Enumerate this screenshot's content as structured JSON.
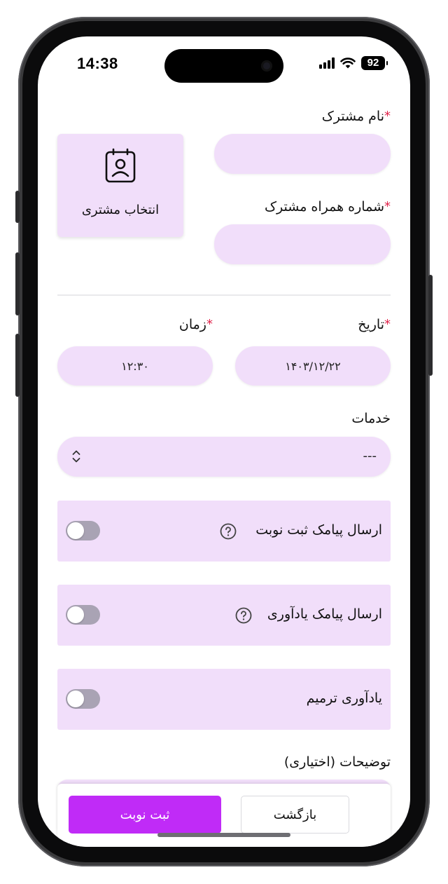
{
  "status_bar": {
    "time": "14:38",
    "battery": "92",
    "icons": [
      "cellular-signal-icon",
      "wifi-icon",
      "battery-icon"
    ]
  },
  "customer": {
    "name_label": "نام مشترک",
    "name_value": "",
    "phone_label": "شماره همراه مشترک",
    "phone_value": "",
    "required_mark": "*",
    "pick_button_label": "انتخاب مشتری",
    "pick_button_icon": "contact-book-icon"
  },
  "appointment": {
    "date_label": "تاریخ",
    "date_value": "۱۴۰۳/۱۲/۲۲",
    "time_label": "زمان",
    "time_value": "۱۲:۳۰"
  },
  "services": {
    "label": "خدمات",
    "selected": "---"
  },
  "toggles": [
    {
      "label": "ارسال پیامک ثبت نوبت",
      "has_help": true,
      "on": false
    },
    {
      "label": "ارسال پیامک یادآوری",
      "has_help": true,
      "on": false
    },
    {
      "label": "یادآوری ترمیم",
      "has_help": false,
      "on": false
    }
  ],
  "notes": {
    "label": "توضیحات (اختیاری)"
  },
  "actions": {
    "back_label": "بازگشت",
    "submit_label": "ثبت نوبت"
  },
  "colors": {
    "field_bg": "#f1defa",
    "primary": "#c02bf7",
    "required": "#e0244b",
    "toggle_off": "#a9a3b4"
  }
}
